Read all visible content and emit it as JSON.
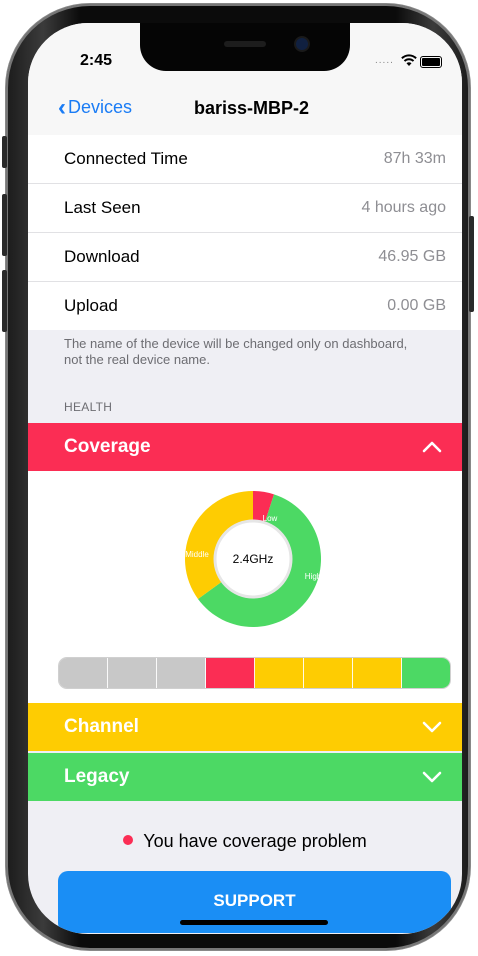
{
  "status_bar": {
    "time": "2:45",
    "signal_dots": "....."
  },
  "nav": {
    "back_label": "Devices",
    "title": "bariss-MBP-2"
  },
  "details": [
    {
      "label": "Connected Time",
      "value": "87h 33m"
    },
    {
      "label": "Last Seen",
      "value": "4 hours ago"
    },
    {
      "label": "Download",
      "value": "46.95 GB"
    },
    {
      "label": "Upload",
      "value": "0.00 GB"
    }
  ],
  "note": "The name of the device will be changed only on dashboard, not the real device name.",
  "health_header": "HEALTH",
  "sections": {
    "coverage": {
      "title": "Coverage",
      "color": "#fb2d54",
      "expanded": true
    },
    "channel": {
      "title": "Channel",
      "color": "#fecc02",
      "expanded": false
    },
    "legacy": {
      "title": "Legacy",
      "color": "#4cd964",
      "expanded": false
    }
  },
  "donut": {
    "center_label": "2.4GHz",
    "slices": [
      {
        "label": "Low",
        "fraction": 0.05,
        "color": "#fb2d54"
      },
      {
        "label": "High",
        "fraction": 0.6,
        "color": "#4cd964"
      },
      {
        "label": "Middle",
        "fraction": 0.35,
        "color": "#fecc02"
      }
    ]
  },
  "coverage_bar": [
    "#c8c8c8",
    "#c8c8c8",
    "#c8c8c8",
    "#fb2d54",
    "#fecc02",
    "#fecc02",
    "#fecc02",
    "#4cd964"
  ],
  "problem_text": "You have coverage problem",
  "support_label": "SUPPORT",
  "colors": {
    "accent": "#1a7cf5",
    "button": "#1a8ef5"
  }
}
